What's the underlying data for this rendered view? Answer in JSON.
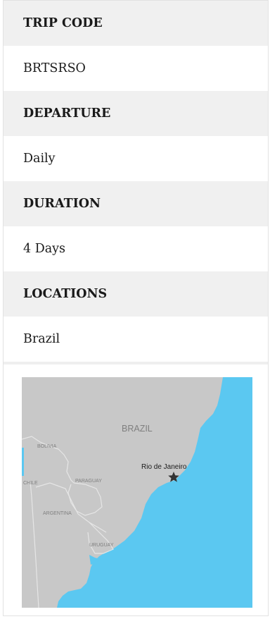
{
  "trip": {
    "code_label": "TRIP CODE",
    "code_value": "BRTSRSO",
    "departure_label": "DEPARTURE",
    "departure_value": "Daily",
    "duration_label": "DURATION",
    "duration_value": "4 Days",
    "locations_label": "LOCATIONS",
    "locations_value": "Brazil"
  },
  "map": {
    "country_labels": {
      "brazil": "BRAZIL",
      "bolivia": "BOLIVIA",
      "chile": "CHILE",
      "paraguay": "PARAGUAY",
      "argentina": "ARGENTINA",
      "uruguay": "URUGUAY"
    },
    "city_label": "Rio de Janeiro",
    "colors": {
      "ocean": "#5bc8f1",
      "land": "#c8c8c8",
      "borders": "#e6e6e6",
      "marker": "#333333"
    }
  }
}
